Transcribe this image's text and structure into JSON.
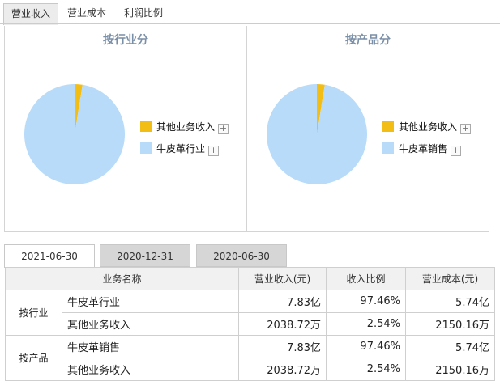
{
  "top_tabs": [
    "营业收入",
    "营业成本",
    "利润比例"
  ],
  "panels": [
    {
      "title": "按行业分",
      "legend": [
        {
          "label": "其他业务收入",
          "color": "#f2bd14"
        },
        {
          "label": "牛皮革行业",
          "color": "#b7dbf9"
        }
      ],
      "values": [
        2.54,
        97.46
      ]
    },
    {
      "title": "按产品分",
      "legend": [
        {
          "label": "其他业务收入",
          "color": "#f2bd14"
        },
        {
          "label": "牛皮革销售",
          "color": "#b7dbf9"
        }
      ],
      "values": [
        2.54,
        97.46
      ]
    }
  ],
  "plus_glyph": "+",
  "date_tabs": [
    "2021-06-30",
    "2020-12-31",
    "2020-06-30"
  ],
  "table": {
    "headers": [
      "业务名称",
      "营业收入(元)",
      "收入比例",
      "营业成本(元)"
    ],
    "groups": [
      {
        "label": "按行业",
        "rows": [
          {
            "name": "牛皮革行业",
            "revenue": "7.83亿",
            "ratio": "97.46%",
            "cost": "5.74亿"
          },
          {
            "name": "其他业务收入",
            "revenue": "2038.72万",
            "ratio": "2.54%",
            "cost": "2150.16万"
          }
        ]
      },
      {
        "label": "按产品",
        "rows": [
          {
            "name": "牛皮革销售",
            "revenue": "7.83亿",
            "ratio": "97.46%",
            "cost": "5.74亿"
          },
          {
            "name": "其他业务收入",
            "revenue": "2038.72万",
            "ratio": "2.54%",
            "cost": "2150.16万"
          }
        ]
      }
    ]
  },
  "colors": {
    "slice_small": "#f2bd14",
    "slice_large": "#b7dbf9",
    "panel_title": "#7a8fa8"
  }
}
